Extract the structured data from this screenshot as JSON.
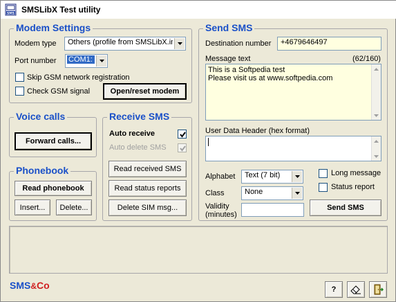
{
  "window": {
    "title": "SMSLibX Test utility"
  },
  "modem": {
    "legend": "Modem Settings",
    "type_label": "Modem type",
    "type_value": "Others (profile from SMSLibX.ini)",
    "port_label": "Port number",
    "port_value": "COM1:",
    "skip_label": "Skip GSM network registration",
    "skip_checked": false,
    "check_signal_label": "Check GSM signal",
    "check_signal_checked": false,
    "open_button": "Open/reset modem"
  },
  "voice": {
    "legend": "Voice calls",
    "forward_button": "Forward calls..."
  },
  "phonebook": {
    "legend": "Phonebook",
    "read_button": "Read phonebook",
    "insert_button": "Insert...",
    "delete_button": "Delete..."
  },
  "receive": {
    "legend": "Receive SMS",
    "auto_receive_label": "Auto receive",
    "auto_receive_checked": true,
    "auto_delete_label": "Auto delete SMS",
    "auto_delete_checked": true,
    "read_received_button": "Read received SMS",
    "read_status_button": "Read status reports",
    "delete_sim_button": "Delete SIM msg..."
  },
  "send": {
    "legend": "Send SMS",
    "dest_label": "Destination number",
    "dest_value": "+4679646497",
    "message_label": "Message text",
    "message_count": "(62/160)",
    "message_line1": "This is a Softpedia test",
    "message_line2": "Please visit us at www.softpedia.com",
    "udh_label": "User Data Header (hex format)",
    "udh_value": "",
    "alphabet_label": "Alphabet",
    "alphabet_value": "Text (7 bit)",
    "class_label": "Class",
    "class_value": "None",
    "validity_label_1": "Validity",
    "validity_label_2": "(minutes)",
    "validity_value": "",
    "long_message_label": "Long message",
    "long_message_checked": false,
    "status_report_label": "Status report",
    "status_report_checked": false,
    "send_button": "Send SMS"
  },
  "footer": {
    "logo_sms": "SMS",
    "logo_amp": "&",
    "logo_co": "Co",
    "help_button": "?"
  },
  "colors": {
    "accent": "#1a50c8",
    "face": "#ece9d8",
    "field": "#ffffe0"
  }
}
